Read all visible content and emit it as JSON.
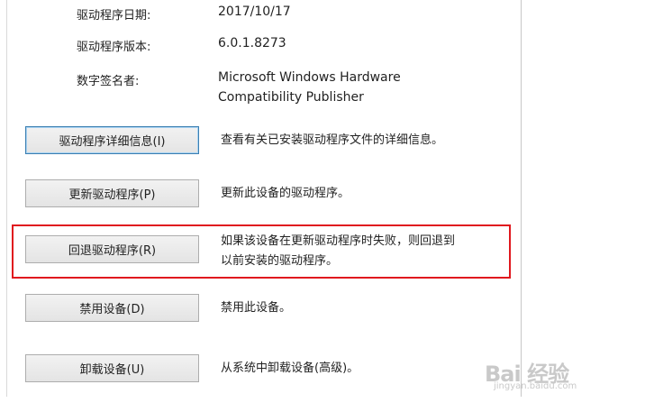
{
  "properties": {
    "driver_date_label": "驱动程序日期:",
    "driver_date_value": "2017/10/17",
    "driver_version_label": "驱动程序版本:",
    "driver_version_value": "6.0.1.8273",
    "signer_label": "数字签名者:",
    "signer_value_line1": "Microsoft Windows Hardware",
    "signer_value_line2": "Compatibility Publisher"
  },
  "actions": {
    "details": {
      "button_label": "驱动程序详细信息(I)",
      "description": "查看有关已安装驱动程序文件的详细信息。"
    },
    "update": {
      "button_label": "更新驱动程序(P)",
      "description": "更新此设备的驱动程序。"
    },
    "rollback": {
      "button_label": "回退驱动程序(R)",
      "description_line1": "如果该设备在更新驱动程序时失败，则回退到",
      "description_line2": "以前安装的驱动程序。"
    },
    "disable": {
      "button_label": "禁用设备(D)",
      "description": "禁用此设备。"
    },
    "uninstall": {
      "button_label": "卸载设备(U)",
      "description": "从系统中卸载设备(高级)。"
    }
  },
  "annotation": {
    "highlight_color": "#e0181e"
  },
  "watermark": {
    "logo_text": "Bai 经验",
    "url_text": "jingyan.baidu.com"
  }
}
